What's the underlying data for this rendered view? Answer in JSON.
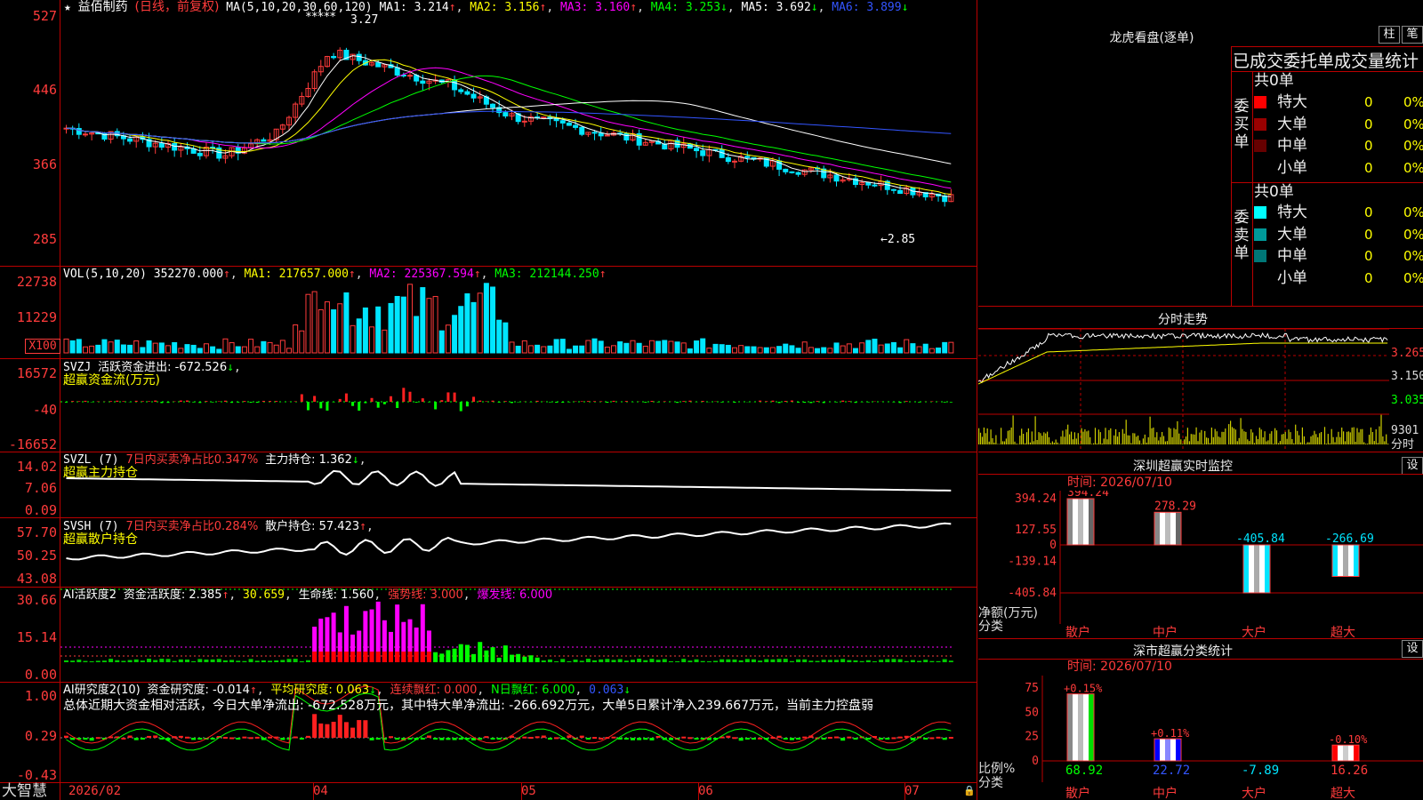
{
  "app": {
    "brand": "大智慧",
    "lock_glyph": "🔒"
  },
  "main": {
    "star": "★",
    "title": "益佰制药",
    "period": "(日线，前复权)",
    "ma_label": "MA(5,10,20,30,60,120)",
    "ma1": "MA1: 3.214",
    "ma2": "MA2: 3.156",
    "ma3": "MA3: 3.160",
    "ma4": "MA4: 3.253",
    "ma5": "MA5: 3.692",
    "ma6": "MA6: 3.899",
    "y_labels": [
      "527",
      "446",
      "366",
      "285"
    ],
    "high_note": "3.27",
    "high_stars": "*****",
    "low_note": "←2.85",
    "colors": {
      "ma1": "#ffffff",
      "ma2": "#ffff00",
      "ma3": "#ff00ff",
      "ma4": "#00ff00",
      "ma5": "#ffffff",
      "ma6": "#3355ff"
    }
  },
  "vol": {
    "label": "VOL(5,10,20)",
    "value": "352270.000",
    "ma1": "MA1: 217657.000",
    "ma2": "MA2: 225367.594",
    "ma3": "MA3: 212144.250",
    "y_labels": [
      "22738",
      "11229"
    ],
    "unit": "X100"
  },
  "svzj": {
    "label": "SVZJ",
    "text": "活跃资金进出: -672.526",
    "subtitle": "超赢资金流(万元)",
    "y_labels": [
      "16572",
      "-40",
      "-16652"
    ]
  },
  "svzl": {
    "label": "SVZL (7)",
    "ratio": "7日内买卖净占比0.347%",
    "hold": "主力持仓: 1.362",
    "subtitle": "超赢主力持仓",
    "y_labels": [
      "14.02",
      "7.06",
      "0.09"
    ]
  },
  "svsh": {
    "label": "SVSH (7)",
    "ratio": "7日内买卖净占比0.284%",
    "hold": "散户持仓: 57.423",
    "subtitle": "超赢散户持仓",
    "y_labels": [
      "57.70",
      "50.25",
      "43.08"
    ]
  },
  "active": {
    "label": "AI活跃度2",
    "v1": "资金活跃度: 2.385",
    "v2": "30.659",
    "v3": "生命线: 1.560",
    "v4": "强势线: 3.000",
    "v5": "爆发线: 6.000",
    "y_labels": [
      "30.66",
      "15.14",
      "0.00"
    ]
  },
  "research": {
    "label": "AI研究度2(10)",
    "v1": "资金研究度: -0.014",
    "v2": "平均研究度: 0.063",
    "v3": "连续飘红: 0.000",
    "v4": "N日飘红: 6.000",
    "v5": "0.063",
    "summary": "总体近期大资金相对活跃，今日大单净流出: -672.528万元，其中特大单净流出: -266.692万元，大单5日累计净入239.667万元，当前主力控盘弱",
    "y_labels": [
      "1.00",
      "0.29",
      "-0.43"
    ]
  },
  "xaxis": {
    "labels": [
      "2026/02",
      "04",
      "05",
      "06",
      "07"
    ]
  },
  "dragon": {
    "title": "龙虎看盘(逐单)",
    "btn_zhu": "柱",
    "btn_bi": "笔",
    "header": "已成交委托单成交量统计",
    "buy_label": "委买单",
    "sell_label": "委卖单",
    "buy_total": "共0单",
    "sell_total": "共0单",
    "buy_rows": [
      {
        "label": "特大",
        "count": "0",
        "pct": "0%",
        "color": "#ff0000"
      },
      {
        "label": "大单",
        "count": "0",
        "pct": "0%",
        "color": "#990000"
      },
      {
        "label": "中单",
        "count": "0",
        "pct": "0%",
        "color": "#660000"
      },
      {
        "label": "小单",
        "count": "0",
        "pct": "0%",
        "color": "#000000"
      }
    ],
    "sell_rows": [
      {
        "label": "特大",
        "count": "0",
        "pct": "0%",
        "color": "#00ffff"
      },
      {
        "label": "大单",
        "count": "0",
        "pct": "0%",
        "color": "#009999"
      },
      {
        "label": "中单",
        "count": "0",
        "pct": "0%",
        "color": "#007777"
      },
      {
        "label": "小单",
        "count": "0",
        "pct": "0%",
        "color": "#000000"
      }
    ]
  },
  "intraday": {
    "title": "分时走势",
    "prices": [
      "3.265",
      "3.150",
      "3.035"
    ],
    "vol_label": "9301",
    "vol_unit": "分时"
  },
  "sz_monitor": {
    "title": "深圳超赢实时监控",
    "btn": "设",
    "time": "时间: 2026/07/10",
    "y_labels": [
      "394.24",
      "127.55",
      "0",
      "-139.14",
      "-405.84"
    ],
    "unit_label": "净额(万元)",
    "cat_label": "分类"
  },
  "sz_stats": {
    "title": "深市超赢分类统计",
    "btn": "设",
    "time": "时间: 2026/07/10",
    "y_labels": [
      "75",
      "50",
      "25",
      "0"
    ],
    "ratio_label": "比例%",
    "cat_label": "分类"
  },
  "chart_data": [
    {
      "type": "bar",
      "title": "深圳超赢实时监控",
      "ylabel": "净额(万元)",
      "categories": [
        "散户",
        "中户",
        "大户",
        "超大"
      ],
      "values": [
        394.24,
        278.29,
        -405.84,
        -266.69
      ],
      "ylim": [
        -405.84,
        394.24
      ]
    },
    {
      "type": "bar",
      "title": "深市超赢分类统计",
      "ylabel": "比例%",
      "categories": [
        "散户",
        "中户",
        "大户",
        "超大"
      ],
      "values": [
        68.92,
        22.72,
        -7.89,
        16.26
      ],
      "annotations": [
        "+0.15%",
        "+0.11%",
        "",
        "-0.10%"
      ],
      "ylim": [
        0,
        75
      ]
    }
  ]
}
